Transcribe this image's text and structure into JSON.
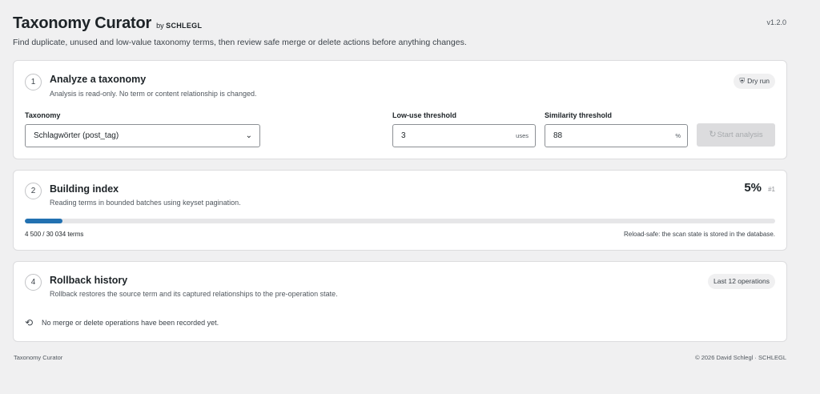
{
  "header": {
    "title": "Taxonomy Curator",
    "by_label": "by",
    "brand": "SCHLEGL",
    "version": "v1.2.0",
    "subtitle": "Find duplicate, unused and low-value taxonomy terms, then review safe merge or delete actions before anything changes."
  },
  "analyze": {
    "step": "1",
    "title": "Analyze a taxonomy",
    "description": "Analysis is read-only. No term or content relationship is changed.",
    "badge": "Dry run",
    "badge_icon": "shield-icon",
    "taxonomy_label": "Taxonomy",
    "taxonomy_value": "Schlagwörter (post_tag)",
    "low_use_label": "Low-use threshold",
    "low_use_value": "3",
    "low_use_unit": "uses",
    "similarity_label": "Similarity threshold",
    "similarity_value": "88",
    "similarity_unit": "%",
    "start_button": "Start analysis",
    "start_icon": "spinner-icon"
  },
  "index": {
    "step": "2",
    "title": "Building index",
    "description": "Reading terms in bounded batches using keyset pagination.",
    "percent_label": "5%",
    "batch_label": "#1",
    "progress_fraction": 0.05,
    "count_text": "4 500 / 30 034 terms",
    "note": "Reload-safe: the scan state is stored in the database.",
    "progress_color": "#2271b1"
  },
  "rollback": {
    "step": "4",
    "title": "Rollback history",
    "description": "Rollback restores the source term and its captured relationships to the pre-operation state.",
    "badge": "Last 12 operations",
    "empty_icon": "history-icon",
    "empty_message": "No merge or delete operations have been recorded yet."
  },
  "footer": {
    "left": "Taxonomy Curator",
    "right": "© 2026 David Schlegl · SCHLEGL"
  }
}
